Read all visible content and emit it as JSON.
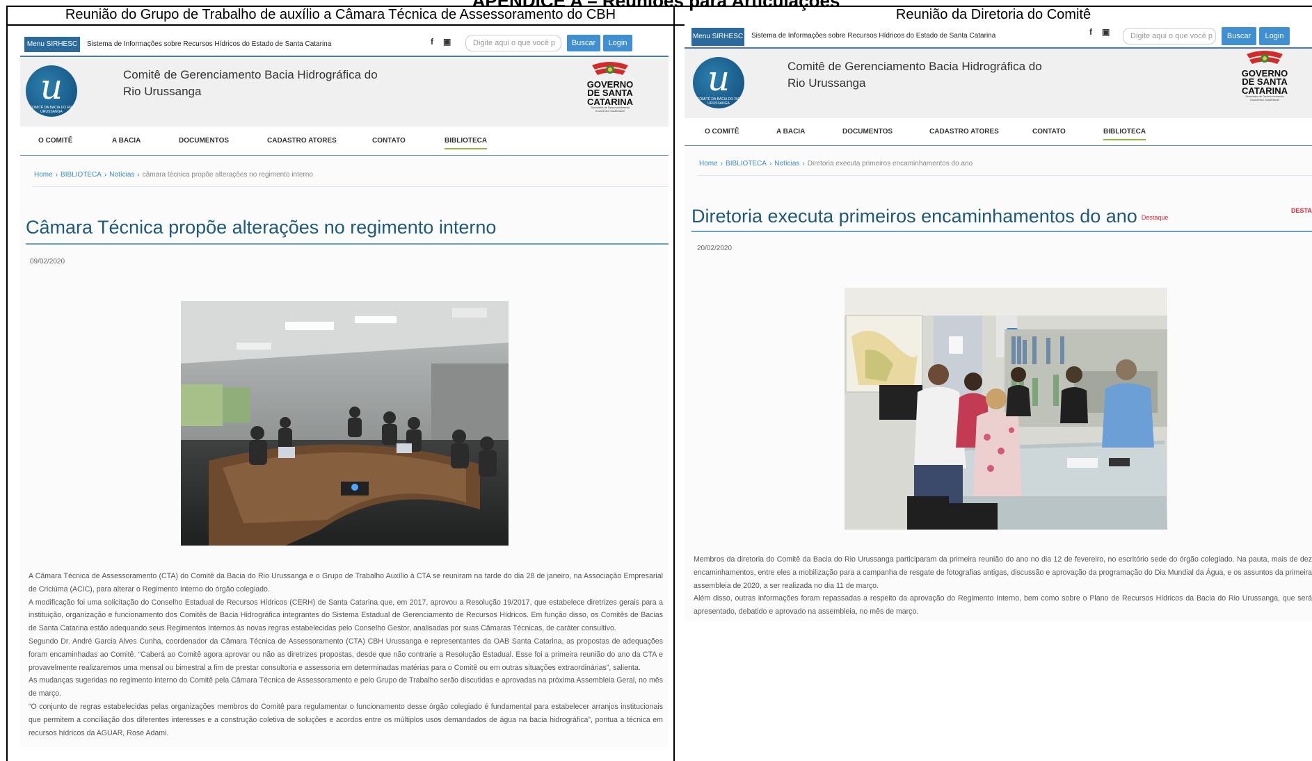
{
  "heading": "APÊNDICE A – Reuniões para Articulações",
  "columns": {
    "left": "Reunião do Grupo de Trabalho de auxílio a Câmara Técnica de Assessoramento do CBH",
    "right": "Reunião da Diretoria do Comitê"
  },
  "site": {
    "menu_button": "Menu SIRHESC",
    "system_name": "Sistema de Informações sobre Recursos Hídricos do Estado de Santa Catarina",
    "social_facebook": "f",
    "social_youtube": "▣",
    "search_placeholder": "Digite aqui o que você p",
    "search_button": "Buscar",
    "login_button": "Login",
    "logo_letter": "u",
    "logo_caption": "COMITÊ DA BACIA DO RIO URUSSANGA",
    "brand_line1": "Comitê de Gerenciamento Bacia Hidrográfica do",
    "brand_line2": "Rio Urussanga",
    "gov_line1": "GOVERNO",
    "gov_line2": "DE SANTA",
    "gov_line3": "CATARINA",
    "gov_small": "Secretaria de Desenvolvimento Econômico Sustentável",
    "nav": [
      "O COMITÊ",
      "A BACIA",
      "DOCUMENTOS",
      "CADASTRO ATORES",
      "CONTATO",
      "BIBLIOTECA"
    ],
    "crumb_home": "Home",
    "crumb_library": "BIBLIOTECA",
    "crumb_news": "Notícias",
    "crumb_sep": "›"
  },
  "left_article": {
    "crumb_current": "câmara técnica propõe alterações no regimento interno",
    "title": "Câmara Técnica propõe alterações no regimento interno",
    "date": "09/02/2020",
    "paragraphs": [
      "A Câmara Técnica de Assessoramento (CTA) do Comitê da Bacia do Rio Urussanga e o Grupo de Trabalho Auxílio à CTA se reuniram na tarde do dia 28 de janeiro, na Associação Empresarial de Criciúma (ACIC), para alterar o Regimento Interno do órgão colegiado.",
      "A modificação foi uma solicitação do Conselho Estadual de Recursos Hídricos (CERH) de Santa Catarina que, em 2017, aprovou a Resolução 19/2017, que estabelece diretrizes gerais para a instituição, organização e funcionamento dos Comitês de Bacia Hidrográfica integrantes do Sistema Estadual de Gerenciamento de Recursos Hídricos. Em função disso, os Comitês de Bacias de Santa Catarina estão adequando seus Regimentos Internos às novas regras estabelecidas pelo Conselho Gestor, analisadas por suas Câmaras Técnicas, de caráter consultivo.",
      "Segundo Dr. André Garcia Alves Cunha, coordenador da Câmara Técnica de Assessoramento (CTA) CBH Urussanga e representantes da OAB Santa Catarina, as propostas de adequações foram encaminhadas ao Comitê. “Caberá ao Comitê agora aprovar ou não as diretrizes propostas, desde que não contrarie a Resolução Estadual. Esse foi a primeira reunião do ano da CTA e provavelmente realizaremos uma mensal ou bimestral a fim de prestar consultoria e assessoria em determinadas matérias para o Comitê ou em outras situações extraordinárias”, salienta.",
      "As mudanças sugeridas no regimento interno do Comitê pela Câmara Técnica de Assessoramento e pelo Grupo de Trabalho serão discutidas e aprovadas na próxima Assembleia Geral, no mês de março.",
      "“O conjunto de regras estabelecidas pelas organizações membros do Comitê para regulamentar o funcionamento desse órgão colegiado é fundamental para estabelecer arranjos institucionais que permitem a conciliação dos diferentes interesses e a construção coletiva de soluções e acordos entre os múltiplos usos demandados de água na bacia hidrográfica”, pontua a técnica em recursos hídricos da AGUAR, Rose Adami."
    ]
  },
  "right_article": {
    "crumb_current": "Diretoria executa primeiros encaminhamentos do ano",
    "title": "Diretoria executa primeiros encaminhamentos do ano",
    "tag": "Destaque",
    "corner_tag": "DESTAQ",
    "date": "20/02/2020",
    "paragraphs": [
      "Membros da diretoria do Comitê da Bacia do Rio Urussanga participaram da primeira reunião do ano no dia 12 de fevereiro, no escritório sede do órgão colegiado. Na pauta, mais de dez encaminhamentos, entre eles a mobilização para a campanha de resgate de fotografias antigas, discussão e aprovação da programação do Dia Mundial da Água, e os assuntos da primeira assembleia de 2020, a ser realizada no dia 11 de março.",
      "Além disso, outras informações foram repassadas a respeito da aprovação do Regimento Interno, bem como sobre o Plano de Recursos Hídricos da Bacia do Rio Urussanga, que será apresentado, debatido e aprovado na assembleia, no mês de março."
    ]
  }
}
